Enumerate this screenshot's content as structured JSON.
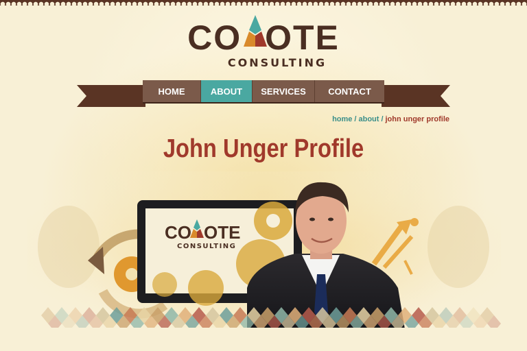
{
  "logo": {
    "word_left": "CO",
    "word_right": "OTE",
    "subtitle": "CONSULTING"
  },
  "nav": {
    "items": [
      {
        "label": "HOME",
        "active": false
      },
      {
        "label": "ABOUT",
        "active": true
      },
      {
        "label": "SERVICES",
        "active": false
      },
      {
        "label": "CONTACT",
        "active": false
      }
    ]
  },
  "breadcrumb": {
    "home": "home",
    "about": "about",
    "current": "john unger profile",
    "separator": "/"
  },
  "page": {
    "title": "John Unger Profile"
  },
  "hero": {
    "screen_logo_left": "CO",
    "screen_logo_right": "OTE",
    "screen_logo_subtitle": "CONSULTING"
  },
  "colors": {
    "brand_brown": "#4a2e22",
    "accent_teal": "#4aa8a1",
    "title_red": "#a0392b",
    "gear_gold": "#d9a93c",
    "background": "#f8f0d6"
  }
}
